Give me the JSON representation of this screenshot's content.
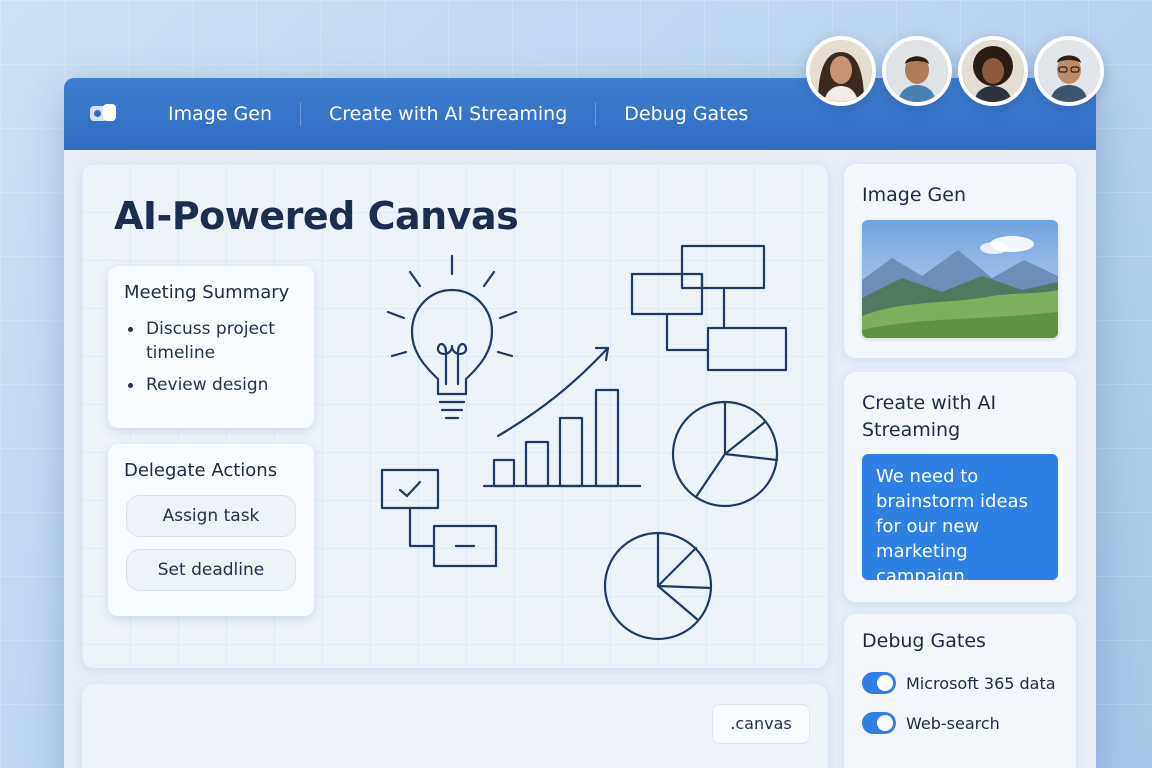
{
  "titlebar": {
    "tabs": [
      "Image Gen",
      "Create with AI Streaming",
      "Debug Gates"
    ]
  },
  "canvas": {
    "title": "AI-Powered Canvas",
    "meeting_summary": {
      "heading": "Meeting Summary",
      "items": [
        "Discuss project timeline",
        "Review design"
      ]
    },
    "delegate_actions": {
      "heading": "Delegate Actions",
      "buttons": [
        "Assign task",
        "Set deadline"
      ]
    }
  },
  "image_gen": {
    "heading": "Image Gen"
  },
  "streaming": {
    "heading": "Create with AI Streaming",
    "prompt": "We need to brainstorm ideas for our new marketing campaign."
  },
  "debug_gates": {
    "heading": "Debug Gates",
    "toggles": [
      {
        "label": "Microsoft 365 data",
        "on": true
      },
      {
        "label": "Web-search",
        "on": true
      }
    ]
  },
  "bottom": {
    "badge": ".canvas"
  },
  "colors": {
    "accent": "#2f80e4",
    "titlebar": "#2f6bc2",
    "ink": "#1f3a63"
  }
}
